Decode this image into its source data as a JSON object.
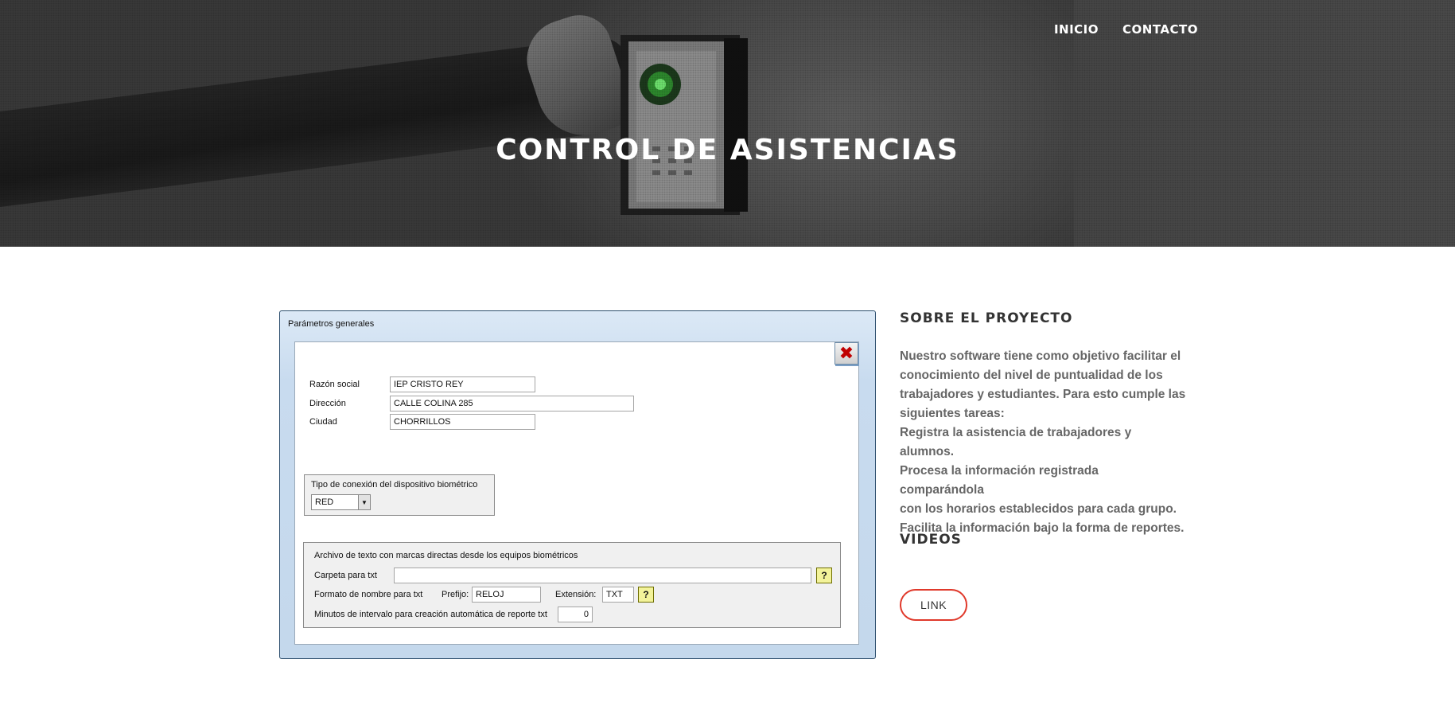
{
  "nav": {
    "items": [
      "INICIO",
      "CONTACTO"
    ]
  },
  "hero": {
    "title": "CONTROL DE ASISTENCIAS"
  },
  "dialog": {
    "title": "Parámetros generales",
    "close_icon": "close-x-icon",
    "fields": [
      {
        "label": "Razón social",
        "value": "IEP CRISTO REY"
      },
      {
        "label": "Dirección",
        "value": "CALLE COLINA 285"
      },
      {
        "label": "Ciudad",
        "value": "CHORRILLOS"
      }
    ],
    "connection_group": {
      "title": "Tipo de conexión del dispositivo biométrico",
      "selected": "RED"
    },
    "text_file_group": {
      "title": "Archivo de texto con marcas directas desde los equipos biométricos",
      "folder_label": "Carpeta para txt",
      "folder_value": "",
      "format_label": "Formato de nombre para txt",
      "prefix_label": "Prefijo:",
      "prefix_value": "RELOJ",
      "extension_label": "Extensión:",
      "extension_value": "TXT",
      "interval_label": "Minutos de intervalo para creación automática de reporte txt",
      "interval_value": "0",
      "help_label": "?"
    }
  },
  "about": {
    "heading": "SOBRE EL PROYECTO",
    "lines": [
      "Nuestro software tiene como objetivo facilitar el",
      "conocimiento del nivel de puntualidad de los",
      "trabajadores y estudiantes. Para esto cumple las",
      "siguientes tareas:",
      "Registra la asistencia de trabajadores y alumnos.",
      "Procesa la información registrada comparándola",
      "con los horarios establecidos para cada grupo.",
      "Facilita la información bajo la forma de reportes."
    ],
    "videos_heading": "VIDEOS",
    "link_label": "LINK"
  },
  "colors": {
    "accent": "#e0392b",
    "hero_bg": "#4a4a4a"
  }
}
